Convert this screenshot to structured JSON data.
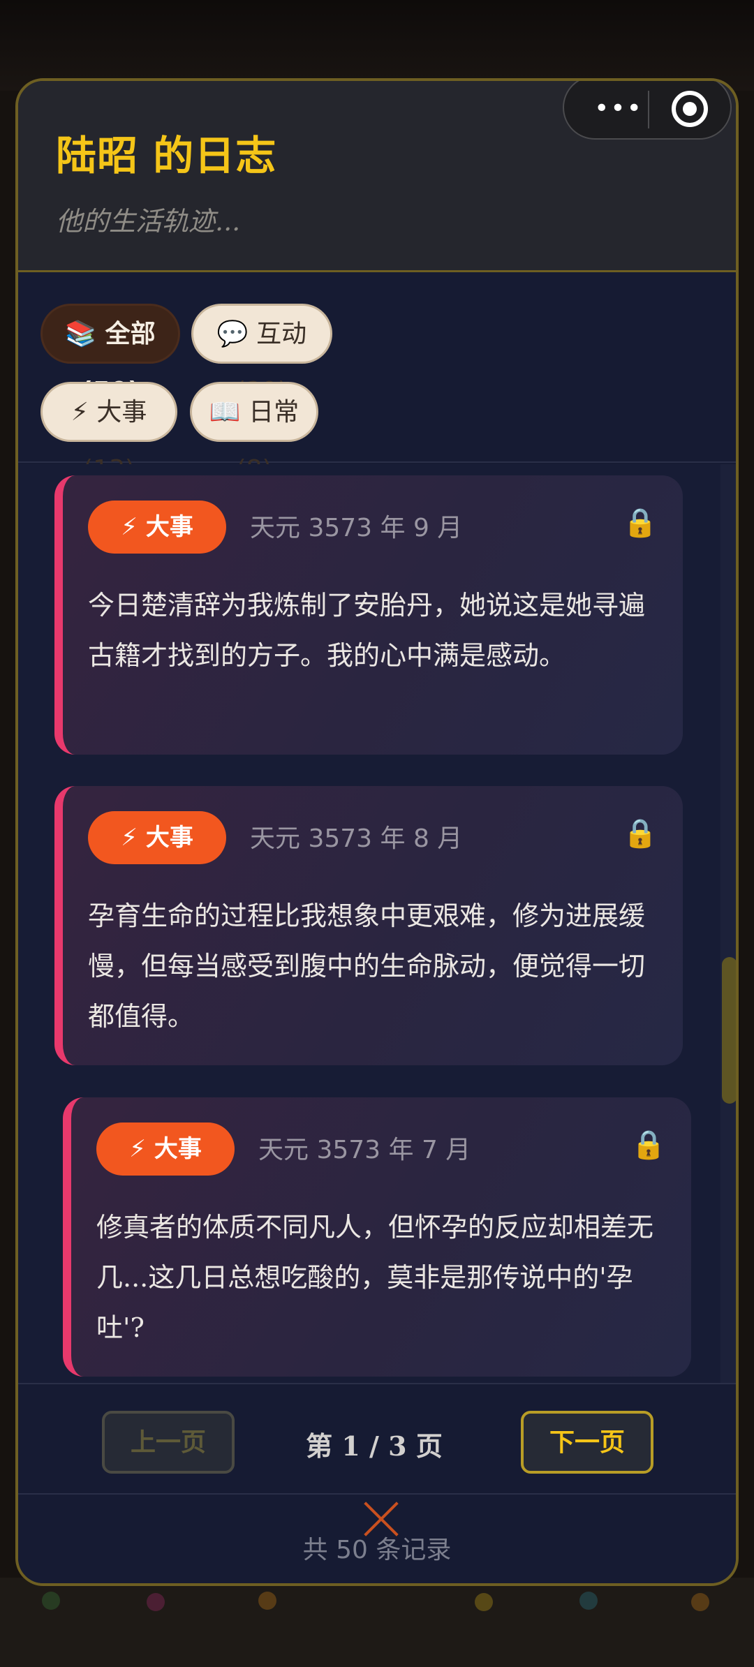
{
  "header": {
    "title": "陆昭 的日志",
    "subtitle": "他的生活轨迹..."
  },
  "capsule": {
    "more_icon": "•••"
  },
  "filters": [
    {
      "label": "📚 全部 (50)",
      "active": true
    },
    {
      "label": "💬 互动 (29)",
      "active": false
    },
    {
      "label": "⚡ 大事 (13)",
      "active": false
    },
    {
      "label": "📖 日常 (8)",
      "active": false
    }
  ],
  "entries": [
    {
      "badge": "⚡ 大事",
      "date": "天元 3573 年 9 月",
      "lock_icon": "🔒",
      "text": "今日楚清辞为我炼制了安胎丹，她说这是她寻遍古籍才找到的方子。我的心中满是感动。"
    },
    {
      "badge": "⚡ 大事",
      "date": "天元 3573 年 8 月",
      "lock_icon": "🔒",
      "text": "孕育生命的过程比我想象中更艰难，修为进展缓慢，但每当感受到腹中的生命脉动，便觉得一切都值得。"
    },
    {
      "badge": "⚡ 大事",
      "date": "天元 3573 年 7 月",
      "lock_icon": "🔒",
      "text": "修真者的体质不同凡人，但怀孕的反应却相差无几...这几日总想吃酸的，莫非是那传说中的'孕吐'?"
    }
  ],
  "pagination": {
    "prev_label": "上一页",
    "page_info": "第 1 / 3 页",
    "next_label": "下一页"
  },
  "footer": {
    "total_label": "共 50 条记录"
  },
  "colors": {
    "accent_gold": "#f5c518",
    "badge_orange": "#f2571f",
    "card_stripe": "#e8396c",
    "modal_bg": "#161b33"
  }
}
